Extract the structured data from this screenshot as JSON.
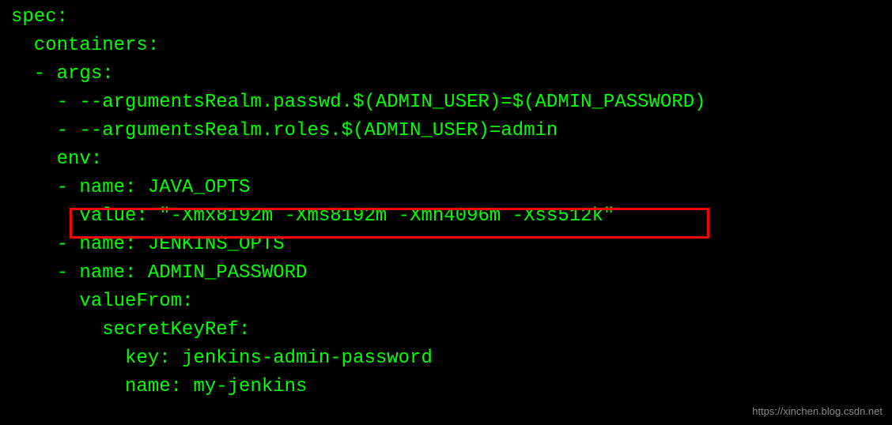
{
  "code": {
    "line1": "spec:",
    "line2": "  containers:",
    "line3": "  - args:",
    "line4": "    - --argumentsRealm.passwd.$(ADMIN_USER)=$(ADMIN_PASSWORD)",
    "line5": "    - --argumentsRealm.roles.$(ADMIN_USER)=admin",
    "line6": "    env:",
    "line7": "    - name: JAVA_OPTS",
    "line8": "      value: \"-Xmx8192m -Xms8192m -Xmn4096m -Xss512k\"",
    "line9": "    - name: JENKINS_OPTS",
    "line10": "    - name: ADMIN_PASSWORD",
    "line11": "      valueFrom:",
    "line12": "        secretKeyRef:",
    "line13": "          key: jenkins-admin-password",
    "line14": "          name: my-jenkins"
  },
  "watermark": "https://xinchen.blog.csdn.net"
}
